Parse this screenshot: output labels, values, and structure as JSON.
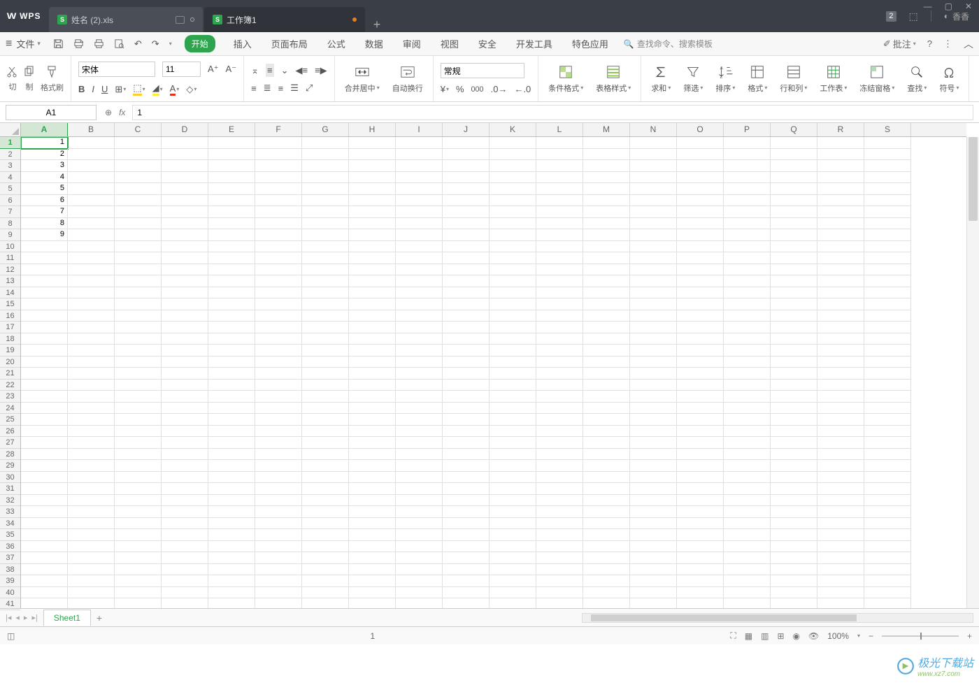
{
  "titlebar": {
    "app": "WPS",
    "tabs": [
      {
        "label": "姓名 (2).xls",
        "active": false,
        "dirty": false
      },
      {
        "label": "工作簿1",
        "active": true,
        "dirty": true
      }
    ],
    "badge": "2",
    "user": "香香"
  },
  "menubar": {
    "file": "文件",
    "tabs": [
      "开始",
      "插入",
      "页面布局",
      "公式",
      "数据",
      "审阅",
      "视图",
      "安全",
      "开发工具",
      "特色应用"
    ],
    "active_tab": "开始",
    "search_placeholder": "查找命令、搜索模板",
    "annotate": "批注"
  },
  "ribbon": {
    "clipboard": {
      "paste": "切",
      "copy": "制",
      "format_painter": "格式刷"
    },
    "font": {
      "name": "宋体",
      "size": "11",
      "increase": "A⁺",
      "decrease": "A⁻",
      "bold": "B",
      "italic": "I",
      "underline": "U"
    },
    "number_format": "常规",
    "merge": "合并居中",
    "wrap": "自动换行",
    "cond_format": "条件格式",
    "table_style": "表格样式",
    "sum": "求和",
    "filter": "筛选",
    "sort": "排序",
    "format": "格式",
    "rowcol": "行和列",
    "worksheet": "工作表",
    "freeze": "冻结窗格",
    "find": "查找",
    "symbol": "符号"
  },
  "formula_bar": {
    "cell_ref": "A1",
    "formula": "1"
  },
  "columns": [
    "A",
    "B",
    "C",
    "D",
    "E",
    "F",
    "G",
    "H",
    "I",
    "J",
    "K",
    "L",
    "M",
    "N",
    "O",
    "P",
    "Q",
    "R",
    "S"
  ],
  "rows": 41,
  "selected": {
    "row": 1,
    "col": "A"
  },
  "data": {
    "A1": "1",
    "A2": "2",
    "A3": "3",
    "A4": "4",
    "A5": "5",
    "A6": "6",
    "A7": "7",
    "A8": "8",
    "A9": "9"
  },
  "sheets": {
    "active": "Sheet1"
  },
  "statusbar": {
    "page": "1",
    "zoom": "100%"
  },
  "watermark": {
    "main": "极光下载站",
    "sub": "www.xz7.com"
  }
}
